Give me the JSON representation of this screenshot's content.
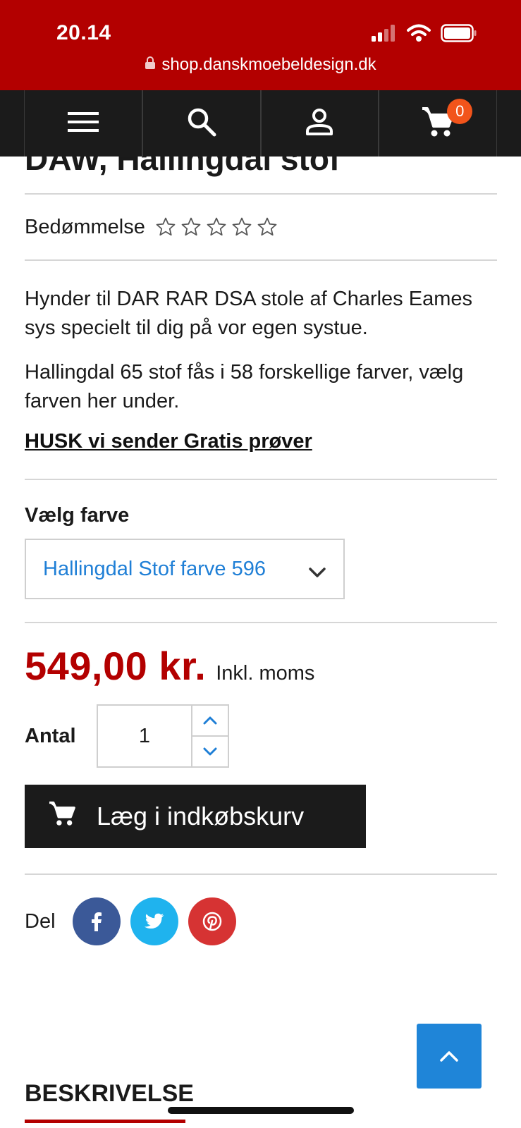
{
  "status_bar": {
    "time": "20.14",
    "url": "shop.danskmoebeldesign.dk",
    "icons": [
      "signal-icon",
      "wifi-icon",
      "battery-icon",
      "lock-icon"
    ]
  },
  "nav": {
    "items": [
      "menu-icon",
      "search-icon",
      "user-icon",
      "cart-icon"
    ],
    "cart_count": "0",
    "badge_color": "#f2541b"
  },
  "product": {
    "title": "DAW, Hallingdal stof",
    "rating_label": "Bedømmelse",
    "rating_value": 0,
    "rating_max": 5,
    "description_1": "Hynder til DAR RAR DSA stole af Charles Eames sys specielt til dig på vor egen systue.",
    "description_2": "Hallingdal  65 stof fås i 58 forskellige farver, vælg farven her under.",
    "samples_link": "HUSK vi sender Gratis prøver",
    "color_label": "Vælg farve",
    "color_selected": "Hallingdal Stof farve 596",
    "price": "549,00 kr.",
    "price_note": "Inkl. moms",
    "quantity_label": "Antal",
    "quantity_value": "1",
    "add_to_cart_label": "Læg i indkøbskurv",
    "share_label": "Del",
    "share_networks": [
      "facebook-icon",
      "twitter-icon",
      "pinterest-icon"
    ]
  },
  "section": {
    "title": "BESKRIVELSE"
  },
  "colors": {
    "brand_red": "#b30000",
    "dark": "#1b1b1b",
    "link_blue": "#1f7fd6",
    "facebook": "#3b5998",
    "twitter": "#1fb3ee",
    "pinterest": "#d63333"
  }
}
